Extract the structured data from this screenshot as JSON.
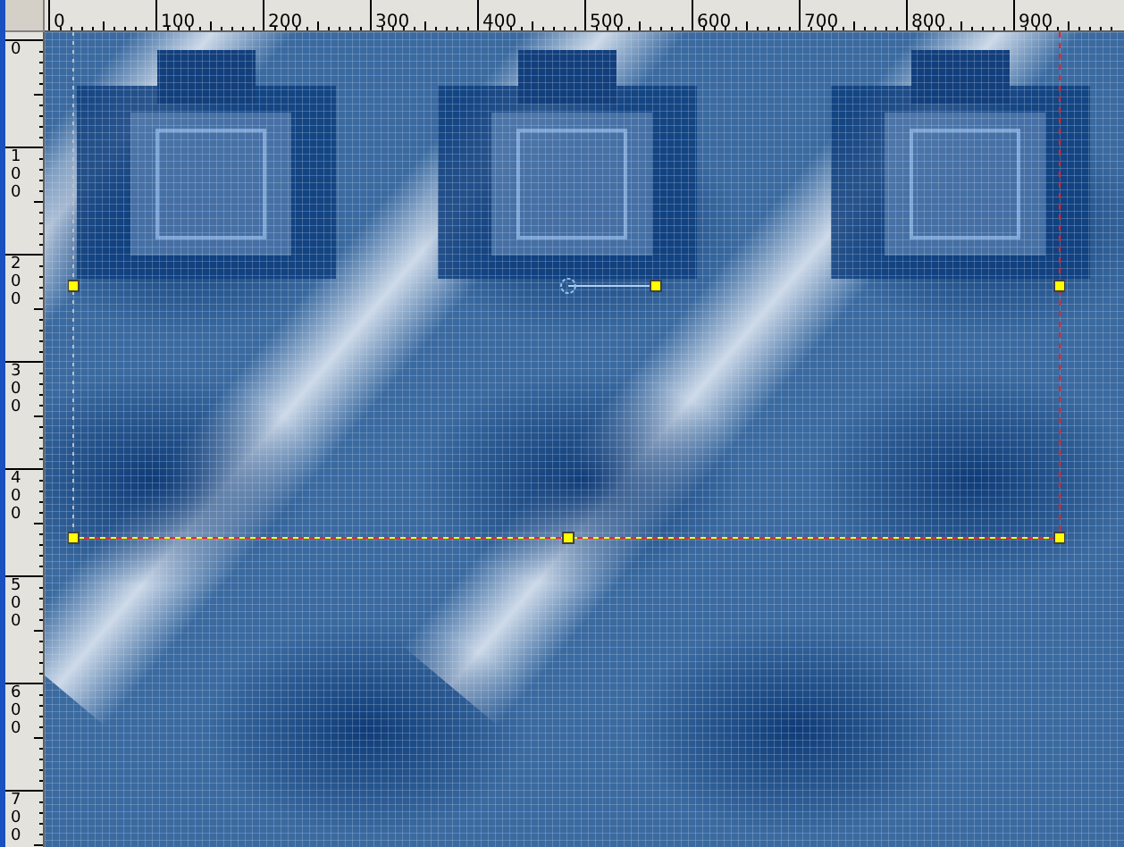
{
  "rulers": {
    "horizontal": [
      "0",
      "100",
      "200",
      "300",
      "400",
      "500",
      "600",
      "700",
      "800",
      "900"
    ],
    "vertical": [
      "0",
      "100",
      "200",
      "300",
      "400",
      "500",
      "600",
      "700"
    ]
  }
}
